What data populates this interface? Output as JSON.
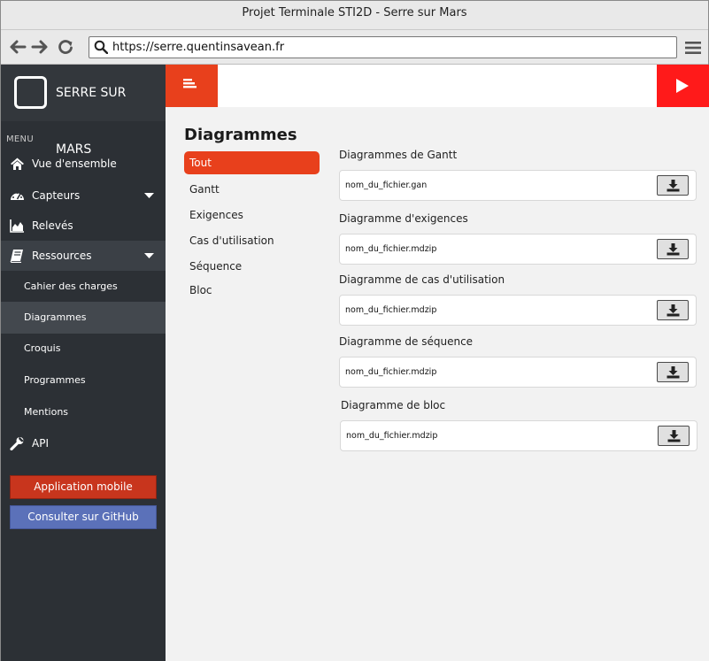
{
  "window": {
    "title": "Projet Terminale STI2D - Serre sur Mars"
  },
  "browser": {
    "url": "https://serre.quentinsavean.fr"
  },
  "brand": {
    "name": "SERRE SUR MARS"
  },
  "sidebar": {
    "menu_label": "MENU",
    "items": [
      {
        "label": "Vue d'ensemble",
        "icon": "home-icon"
      },
      {
        "label": "Capteurs",
        "icon": "dashboard-icon"
      },
      {
        "label": "Relevés",
        "icon": "area-chart-icon"
      },
      {
        "label": "Ressources",
        "icon": "book-icon"
      },
      {
        "label": "API",
        "icon": "wrench-icon"
      }
    ],
    "subitems": [
      {
        "label": "Cahier des charges"
      },
      {
        "label": "Diagrammes"
      },
      {
        "label": "Croquis"
      },
      {
        "label": "Programmes"
      },
      {
        "label": "Mentions"
      }
    ],
    "mobile_button": "Application mobile",
    "github_button": "Consulter sur GitHub"
  },
  "main": {
    "title": "Diagrammes",
    "filters": [
      "Tout",
      "Gantt",
      "Exigences",
      "Cas d'utilisation",
      "Séquence",
      "Bloc"
    ],
    "sections": [
      {
        "title": "Diagrammes de Gantt",
        "file": "nom_du_fichier.gan"
      },
      {
        "title": "Diagramme d'exigences",
        "file": "nom_du_fichier.mdzip"
      },
      {
        "title": "Diagramme de cas d'utilisation",
        "file": "nom_du_fichier.mdzip"
      },
      {
        "title": "Diagramme de séquence",
        "file": "nom_du_fichier.mdzip"
      },
      {
        "title": "Diagramme de bloc",
        "file": "nom_du_fichier.mdzip"
      }
    ]
  },
  "colors": {
    "accent": "#e8401c",
    "play": "#ff1a1a",
    "sidebar": "#2c3035",
    "mobile_button": "#c8351d",
    "github_button": "#5b71b9"
  }
}
